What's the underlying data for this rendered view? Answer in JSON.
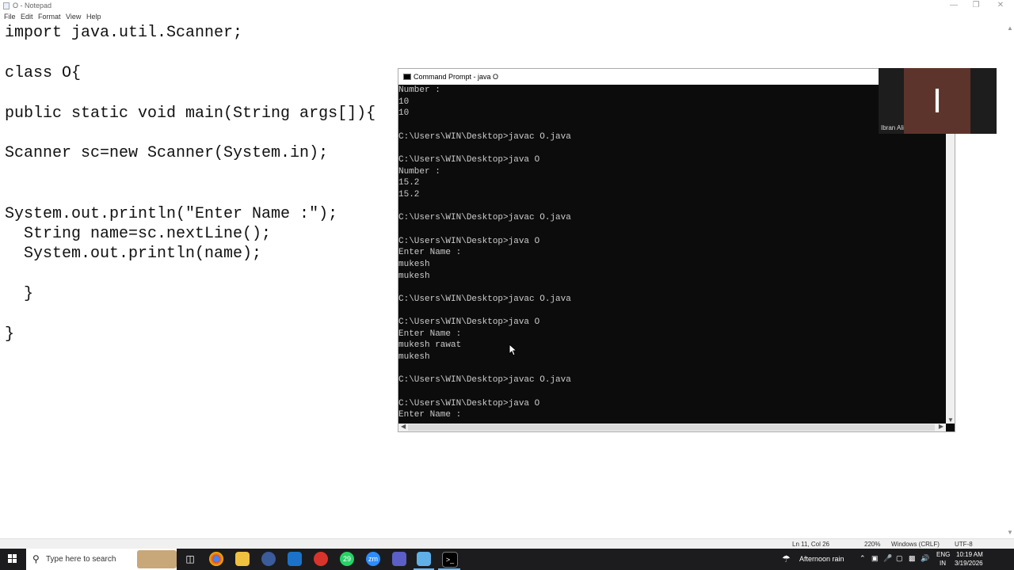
{
  "notepad": {
    "title": "O - Notepad",
    "menu": [
      "File",
      "Edit",
      "Format",
      "View",
      "Help"
    ],
    "code_lines": [
      "import java.util.Scanner;",
      "",
      "class O{",
      "",
      "public static void main(String args[]){",
      "",
      "Scanner sc=new Scanner(System.in);",
      "",
      "",
      "System.out.println(\"Enter Name :\");",
      "  String name=sc.nextLine();",
      "  System.out.println(name);",
      "",
      "  }",
      "",
      "}"
    ],
    "status": {
      "position": "Ln 11, Col 26",
      "zoom": "220%",
      "line_ending": "Windows (CRLF)",
      "encoding": "UTF-8"
    }
  },
  "cmd": {
    "title": "Command Prompt - java  O",
    "lines": [
      "Number :",
      "10",
      "10",
      "",
      "C:\\Users\\WIN\\Desktop>javac O.java",
      "",
      "C:\\Users\\WIN\\Desktop>java O",
      "Number :",
      "15.2",
      "15.2",
      "",
      "C:\\Users\\WIN\\Desktop>javac O.java",
      "",
      "C:\\Users\\WIN\\Desktop>java O",
      "Enter Name :",
      "mukesh",
      "mukesh",
      "",
      "C:\\Users\\WIN\\Desktop>javac O.java",
      "",
      "C:\\Users\\WIN\\Desktop>java O",
      "Enter Name :",
      "mukesh rawat",
      "mukesh",
      "",
      "C:\\Users\\WIN\\Desktop>javac O.java",
      "",
      "C:\\Users\\WIN\\Desktop>java O",
      "Enter Name :"
    ]
  },
  "webcam": {
    "initial": "I",
    "name": "Ibran Ali"
  },
  "taskbar": {
    "search_placeholder": "Type here to search",
    "apps": [
      {
        "icon": "task-view-icon",
        "label": ""
      },
      {
        "icon": "chrome-icon",
        "label": ""
      },
      {
        "icon": "file-explorer-icon",
        "label": ""
      },
      {
        "icon": "app-icon",
        "label": ""
      },
      {
        "icon": "outlook-icon",
        "label": ""
      },
      {
        "icon": "wps-office-icon",
        "label": ""
      },
      {
        "icon": "whatsapp-icon",
        "label": "29"
      },
      {
        "icon": "zoom-icon",
        "label": "zm"
      },
      {
        "icon": "teams-icon",
        "label": ""
      },
      {
        "icon": "notepad-icon",
        "label": ""
      },
      {
        "icon": "command-prompt-icon",
        "label": ""
      }
    ],
    "weather": "Afternoon rain",
    "language": "ENG",
    "region": "IN",
    "time": "10:19 AM",
    "date": "3/19/2026"
  },
  "colors": {
    "cmd_bg": "#0c0c0c",
    "cmd_fg": "#cccccc",
    "taskbar_bg": "#1c1c1e",
    "webcam_avatar": "#5d342c"
  }
}
